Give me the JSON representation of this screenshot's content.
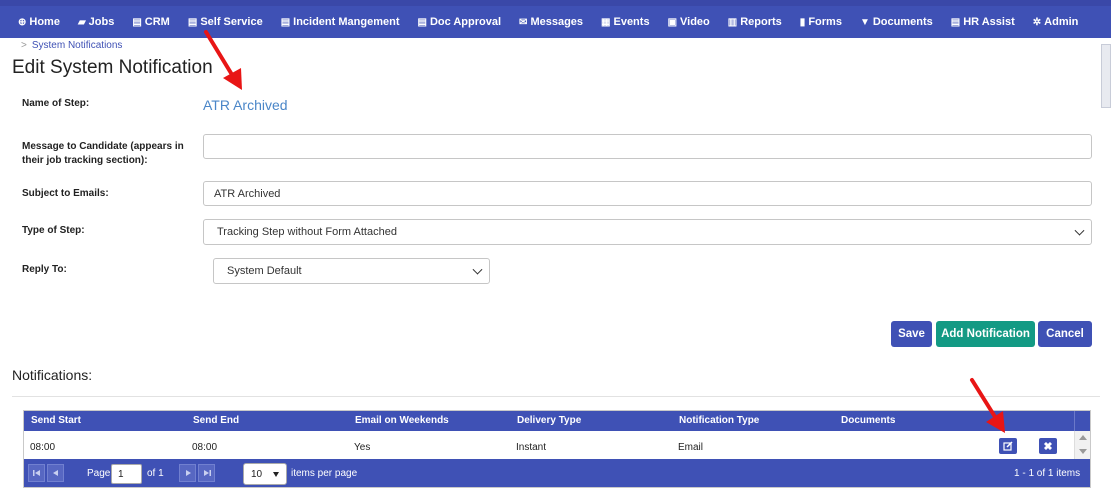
{
  "nav": [
    {
      "label": "Home",
      "icon": "home-icon",
      "glyph": "⊕"
    },
    {
      "label": "Jobs",
      "icon": "folder-icon",
      "glyph": "▰"
    },
    {
      "label": "CRM",
      "icon": "crm-icon",
      "glyph": "▤"
    },
    {
      "label": "Self Service",
      "icon": "list-icon",
      "glyph": "▤"
    },
    {
      "label": "Incident Mangement",
      "icon": "list-icon",
      "glyph": "▤"
    },
    {
      "label": "Doc Approval",
      "icon": "list-icon",
      "glyph": "▤"
    },
    {
      "label": "Messages",
      "icon": "envelope-icon",
      "glyph": "✉"
    },
    {
      "label": "Events",
      "icon": "calendar-icon",
      "glyph": "▦"
    },
    {
      "label": "Video",
      "icon": "video-icon",
      "glyph": "▣"
    },
    {
      "label": "Reports",
      "icon": "report-icon",
      "glyph": "▥"
    },
    {
      "label": "Forms",
      "icon": "file-icon",
      "glyph": "▮"
    },
    {
      "label": "Documents",
      "icon": "filter-icon",
      "glyph": "▼"
    },
    {
      "label": "HR Assist",
      "icon": "hr-icon",
      "glyph": "▤"
    },
    {
      "label": "Admin",
      "icon": "gear-icon",
      "glyph": "✲"
    }
  ],
  "breadcrumb": {
    "separator": ">",
    "current": "System Notifications"
  },
  "page_title": "Edit System Notification",
  "form": {
    "name_label": "Name of Step:",
    "name_value": "ATR Archived",
    "message_label": "Message to Candidate (appears in their job tracking section):",
    "message_value": "",
    "subject_label": "Subject to Emails:",
    "subject_value": "ATR Archived",
    "type_label": "Type of Step:",
    "type_value": "Tracking Step without Form Attached",
    "reply_label": "Reply To:",
    "reply_value": "System Default"
  },
  "buttons": {
    "save": "Save",
    "add": "Add Notification",
    "cancel": "Cancel"
  },
  "notifications": {
    "title": "Notifications:",
    "columns": [
      "Send Start",
      "Send End",
      "Email on Weekends",
      "Delivery Type",
      "Notification Type",
      "Documents"
    ],
    "rows": [
      {
        "send_start": "08:00",
        "send_end": "08:00",
        "weekends": "Yes",
        "delivery": "Instant",
        "type": "Email",
        "documents": ""
      }
    ],
    "pager": {
      "page_label": "Page",
      "page": "1",
      "of_label": "of 1",
      "page_size": "10",
      "per_page_label": "items per page",
      "summary": "1 - 1 of 1 items"
    }
  },
  "colors": {
    "primary": "#3f51b5",
    "success": "#139a84",
    "link": "#4a86c8",
    "arrow": "#e81515"
  }
}
